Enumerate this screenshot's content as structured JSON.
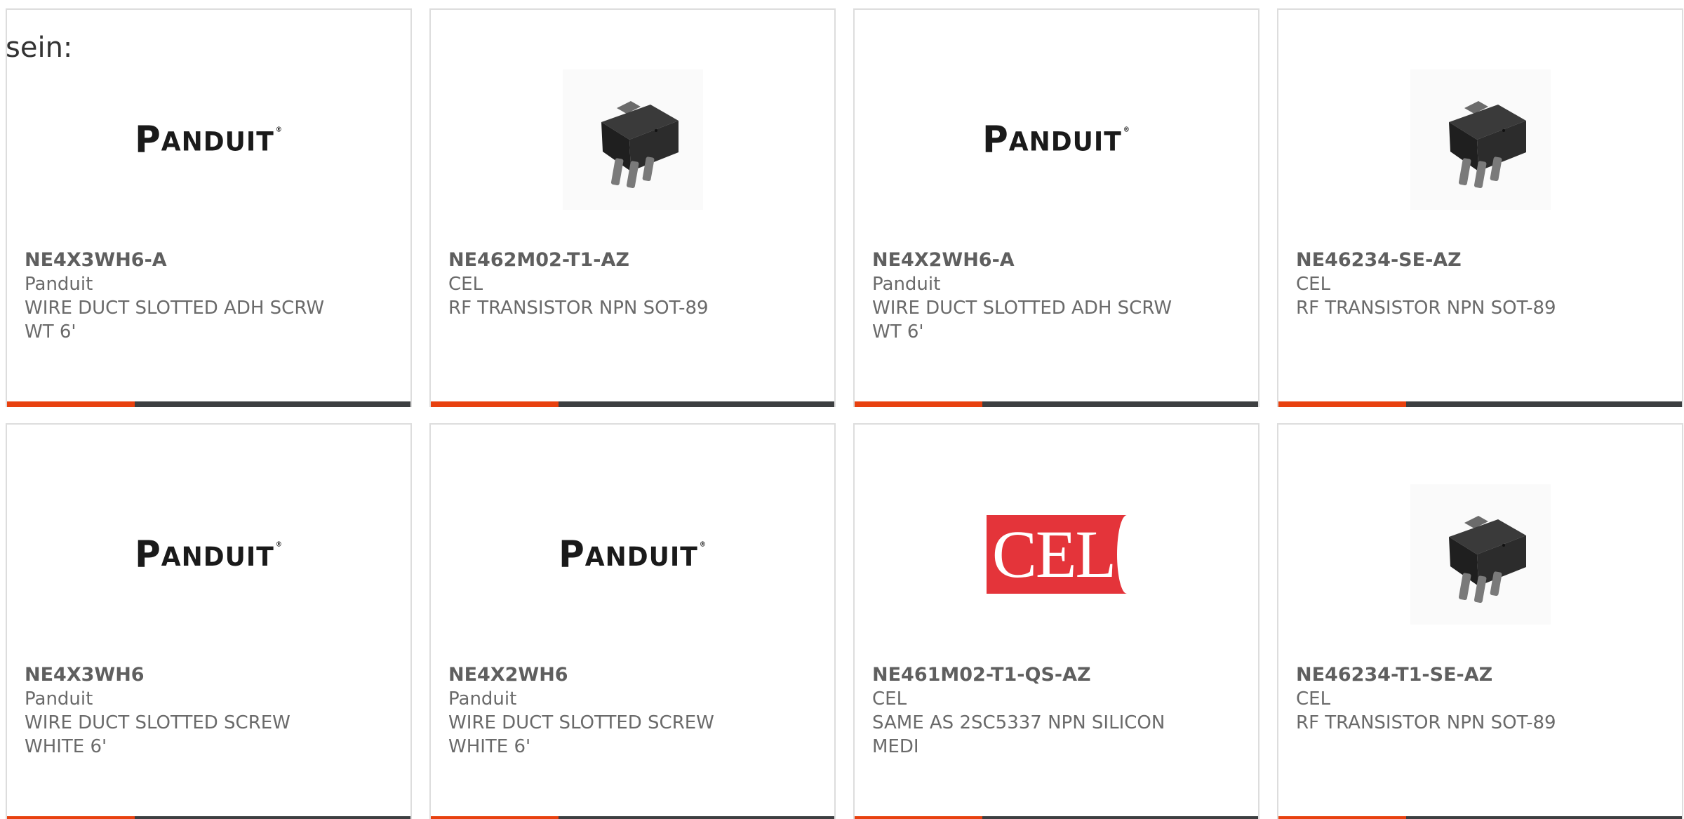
{
  "intro_text": "sein:",
  "colors": {
    "accent_bar": "#e8410f",
    "dark_bar": "#3d3f41"
  },
  "cards": [
    {
      "part_number": "NE4X3WH6-A",
      "manufacturer": "Panduit",
      "description": "WIRE DUCT SLOTTED ADH SCRW WT 6'",
      "image": "panduit-logo",
      "logo_text": {
        "initial": "P",
        "rest": "ANDUIT",
        "mark": "®"
      }
    },
    {
      "part_number": "NE462M02-T1-AZ",
      "manufacturer": "CEL",
      "description": "RF TRANSISTOR NPN SOT-89",
      "image": "transistor-sot89"
    },
    {
      "part_number": "NE4X2WH6-A",
      "manufacturer": "Panduit",
      "description": "WIRE DUCT SLOTTED ADH SCRW WT 6'",
      "image": "panduit-logo",
      "logo_text": {
        "initial": "P",
        "rest": "ANDUIT",
        "mark": "®"
      }
    },
    {
      "part_number": "NE46234-SE-AZ",
      "manufacturer": "CEL",
      "description": "RF TRANSISTOR NPN SOT-89",
      "image": "transistor-sot89"
    },
    {
      "part_number": "NE4X3WH6",
      "manufacturer": "Panduit",
      "description": "WIRE DUCT SLOTTED SCREW WHITE 6'",
      "image": "panduit-logo",
      "logo_text": {
        "initial": "P",
        "rest": "ANDUIT",
        "mark": "®"
      }
    },
    {
      "part_number": "NE4X2WH6",
      "manufacturer": "Panduit",
      "description": "WIRE DUCT SLOTTED SCREW WHITE 6'",
      "image": "panduit-logo",
      "logo_text": {
        "initial": "P",
        "rest": "ANDUIT",
        "mark": "®"
      }
    },
    {
      "part_number": "NE461M02-T1-QS-AZ",
      "manufacturer": "CEL",
      "description": "SAME AS 2SC5337 NPN SILICON MEDI",
      "image": "cel-logo",
      "logo_text": {
        "text": "CEL"
      }
    },
    {
      "part_number": "NE46234-T1-SE-AZ",
      "manufacturer": "CEL",
      "description": "RF TRANSISTOR NPN SOT-89",
      "image": "transistor-sot89"
    }
  ]
}
